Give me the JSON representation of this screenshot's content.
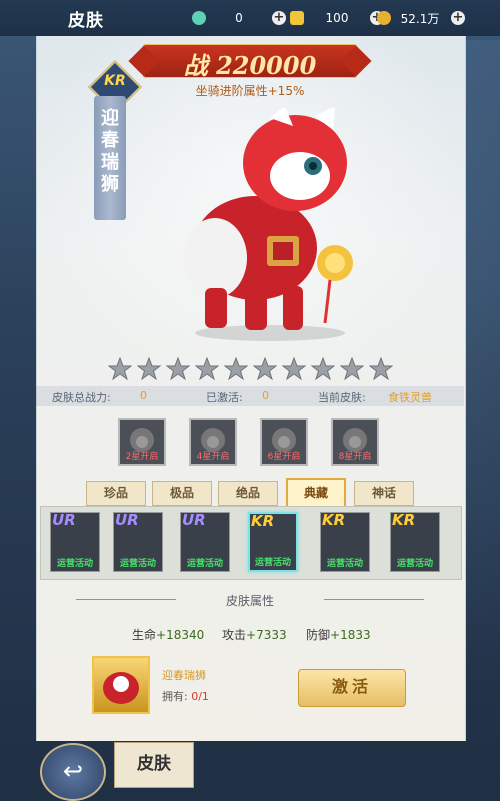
{
  "header": {
    "title": "皮肤",
    "currencies": [
      {
        "icon": "jade-icon",
        "value": "0",
        "color": "#5fd2b6"
      },
      {
        "icon": "gold-ingot-icon",
        "value": "100",
        "color": "#f2c43a"
      },
      {
        "icon": "coin-icon",
        "value": "52.1万",
        "color": "#e8b030"
      }
    ]
  },
  "skin": {
    "grade": "KR",
    "name": "迎春瑞狮",
    "power_label": "战 220000",
    "bonus": "坐骑进阶属性+15%",
    "stars_total": 10,
    "stars_lit": 0
  },
  "info": {
    "total_label": "皮肤总战力:",
    "total_value": "0",
    "activated_label": "已激活:",
    "activated_value": "0",
    "current_label": "当前皮肤:",
    "current_value": "食铁灵兽"
  },
  "star_slots": [
    "2星开启",
    "4星开启",
    "6星开启",
    "8星开启"
  ],
  "tabs": [
    "珍品",
    "极品",
    "绝品",
    "典藏",
    "神话"
  ],
  "active_tab": 3,
  "cards": [
    {
      "grade": "UR",
      "label": "运营活动",
      "color": "#a78cff"
    },
    {
      "grade": "UR",
      "label": "运营活动",
      "color": "#a78cff"
    },
    {
      "grade": "UR",
      "label": "运营活动",
      "color": "#a78cff"
    },
    {
      "grade": "KR",
      "label": "运营活动",
      "color": "#ffcd3a"
    },
    {
      "grade": "KR",
      "label": "运营活动",
      "color": "#ffcd3a"
    },
    {
      "grade": "KR",
      "label": "运营活动",
      "color": "#ffcd3a"
    }
  ],
  "selected_card": 3,
  "attributes": {
    "title": "皮肤属性",
    "stats": [
      {
        "label": "生命",
        "value": "+18340"
      },
      {
        "label": "攻击",
        "value": "+7333"
      },
      {
        "label": "防御",
        "value": "+1833"
      }
    ]
  },
  "item": {
    "name": "迎春瑞狮",
    "own_label": "拥有:",
    "own_value": "0/1",
    "activate_label": "激活"
  },
  "footer": {
    "skin_label": "皮肤"
  }
}
